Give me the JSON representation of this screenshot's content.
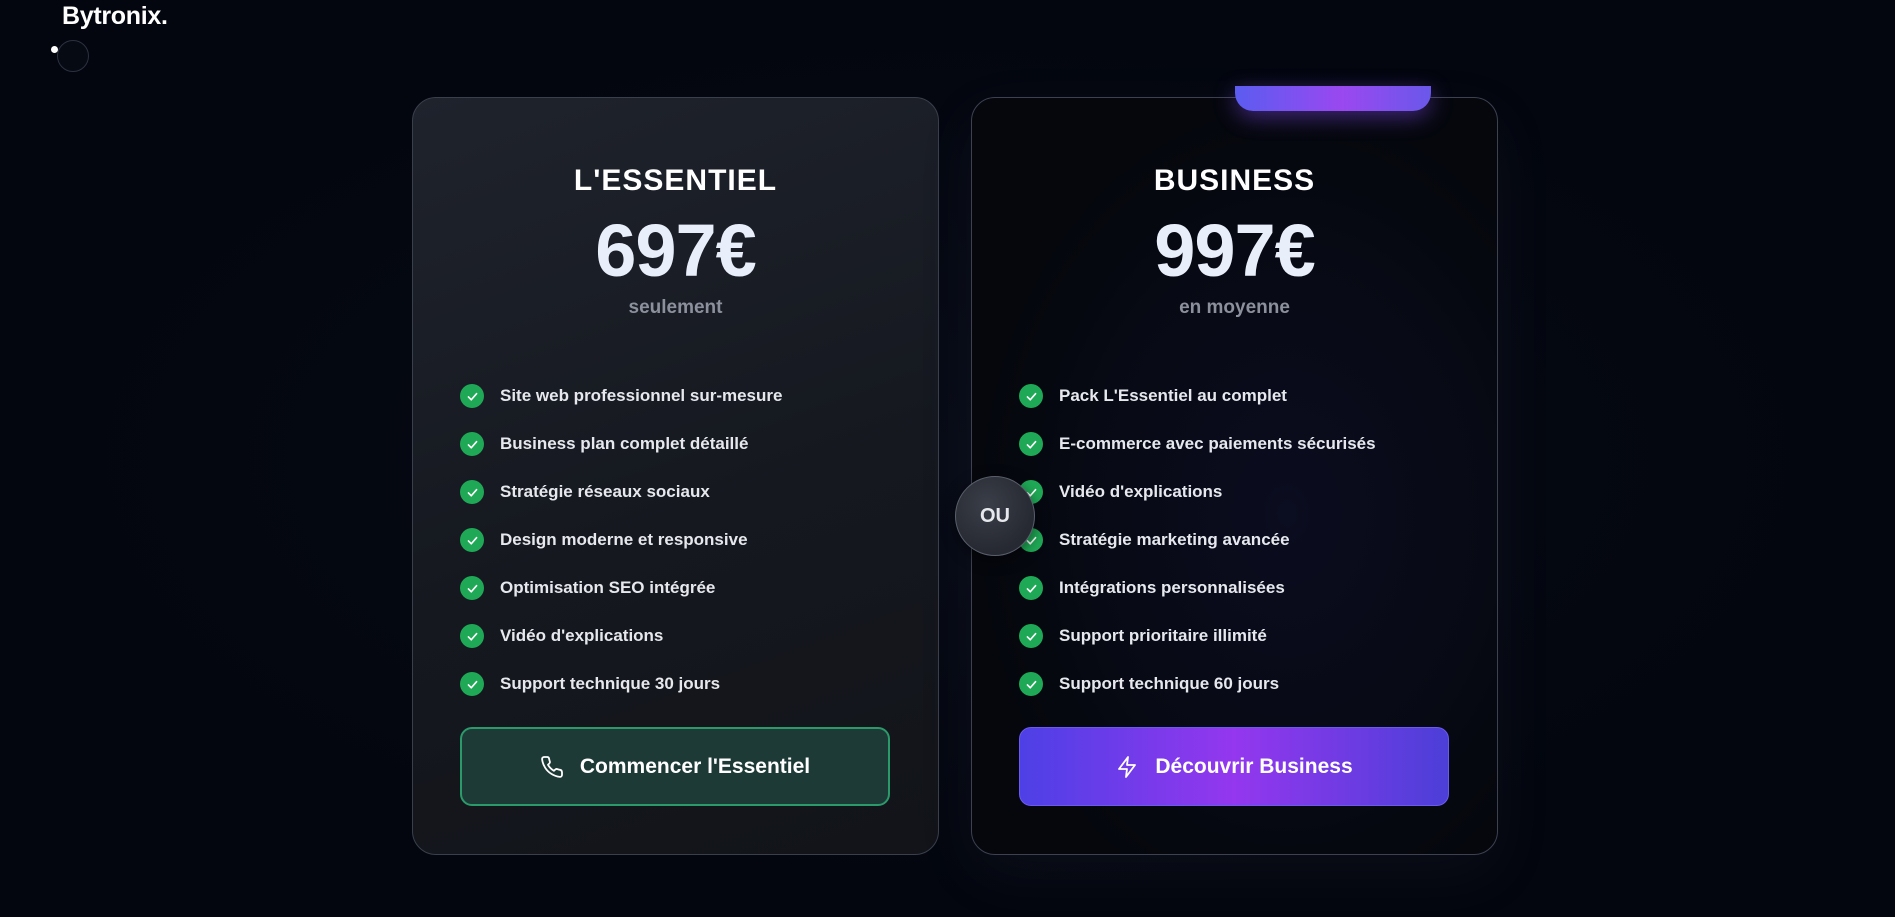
{
  "brand": {
    "logo": "Bytronix."
  },
  "plans": [
    {
      "name": "L'ESSENTIEL",
      "price": "697€",
      "sub": "seulement",
      "features": [
        "Site web professionnel sur-mesure",
        "Business plan complet détaillé",
        "Stratégie réseaux sociaux",
        "Design moderne et responsive",
        "Optimisation SEO intégrée",
        "Vidéo d'explications",
        "Support technique 30 jours"
      ],
      "cta": {
        "label": "Commencer l'Essentiel",
        "icon": "phone-icon"
      },
      "accent": "#1fa956"
    },
    {
      "name": "BUSINESS",
      "price": "997€",
      "sub": "en moyenne",
      "features": [
        "Pack L'Essentiel au complet",
        "E-commerce avec paiements sécurisés",
        "Vidéo d'explications",
        "Stratégie marketing avancée",
        "Intégrations personnalisées",
        "Support prioritaire illimité",
        "Support technique 60 jours"
      ],
      "cta": {
        "label": "Découvrir Business",
        "icon": "lightning-icon"
      },
      "accent": "#9437ee"
    }
  ],
  "divider": {
    "label": "OU"
  },
  "colors": {
    "background": "#03060e",
    "check_green": "#1fa956",
    "cta_green_border": "#2b9a6a",
    "cta_purple_start": "#4d40e6",
    "cta_purple_mid": "#9437ee"
  }
}
